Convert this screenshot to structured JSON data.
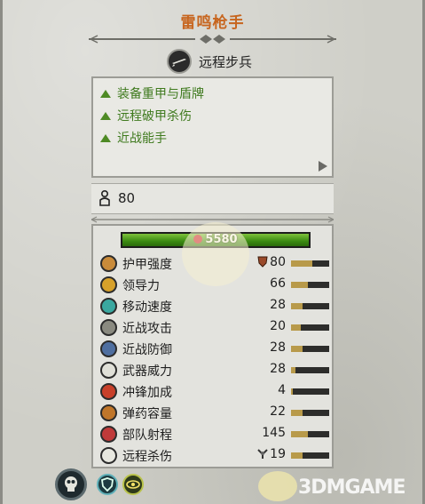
{
  "unit": {
    "name": "雷鸣枪手",
    "type": "远程步兵",
    "icon": "musket-icon"
  },
  "traits": [
    {
      "label": "装备重甲与盾牌",
      "icon": "up-triangle-icon"
    },
    {
      "label": "远程破甲杀伤",
      "icon": "up-triangle-icon"
    },
    {
      "label": "近战能手",
      "icon": "up-triangle-icon"
    }
  ],
  "men": {
    "icon": "soldier-icon",
    "value": "80"
  },
  "health": {
    "value": "5580",
    "fraction": 1.0,
    "icon": "shield-icon"
  },
  "stats": [
    {
      "label": "护甲强度",
      "value": "80",
      "value_icon": "armor-shield-icon",
      "icon": "armor-icon",
      "fraction": 0.55,
      "color": "#c98b3a"
    },
    {
      "label": "领导力",
      "value": "66",
      "icon": "leadership-icon",
      "fraction": 0.45,
      "color": "#d7a12a"
    },
    {
      "label": "移动速度",
      "value": "28",
      "icon": "speed-icon",
      "fraction": 0.3,
      "color": "#3aa8a0"
    },
    {
      "label": "近战攻击",
      "value": "20",
      "icon": "melee-attack-icon",
      "fraction": 0.25,
      "color": "#8a8a80"
    },
    {
      "label": "近战防御",
      "value": "28",
      "icon": "melee-defence-icon",
      "fraction": 0.3,
      "color": "#4f6fa0"
    },
    {
      "label": "武器威力",
      "value": "28",
      "icon": "weapon-strength-icon",
      "fraction": 0.12,
      "color": "#e0e0d8"
    },
    {
      "label": "冲锋加成",
      "value": "4",
      "icon": "charge-bonus-icon",
      "fraction": 0.04,
      "color": "#c8402a"
    },
    {
      "label": "弹药容量",
      "value": "22",
      "icon": "ammunition-icon",
      "fraction": 0.3,
      "color": "#c0762a"
    },
    {
      "label": "部队射程",
      "value": "145",
      "icon": "range-icon",
      "fraction": 0.45,
      "color": "#c03a3a"
    },
    {
      "label": "远程杀伤",
      "value": "19",
      "value_icon": "armor-piercing-icon",
      "icon": "missile-damage-icon",
      "fraction": 0.3,
      "color": "#e8e8e0"
    }
  ],
  "bottom_icons": [
    "faction-skull-icon",
    "shield-ability-icon",
    "eye-ability-icon"
  ],
  "watermark": "3DMGAME"
}
